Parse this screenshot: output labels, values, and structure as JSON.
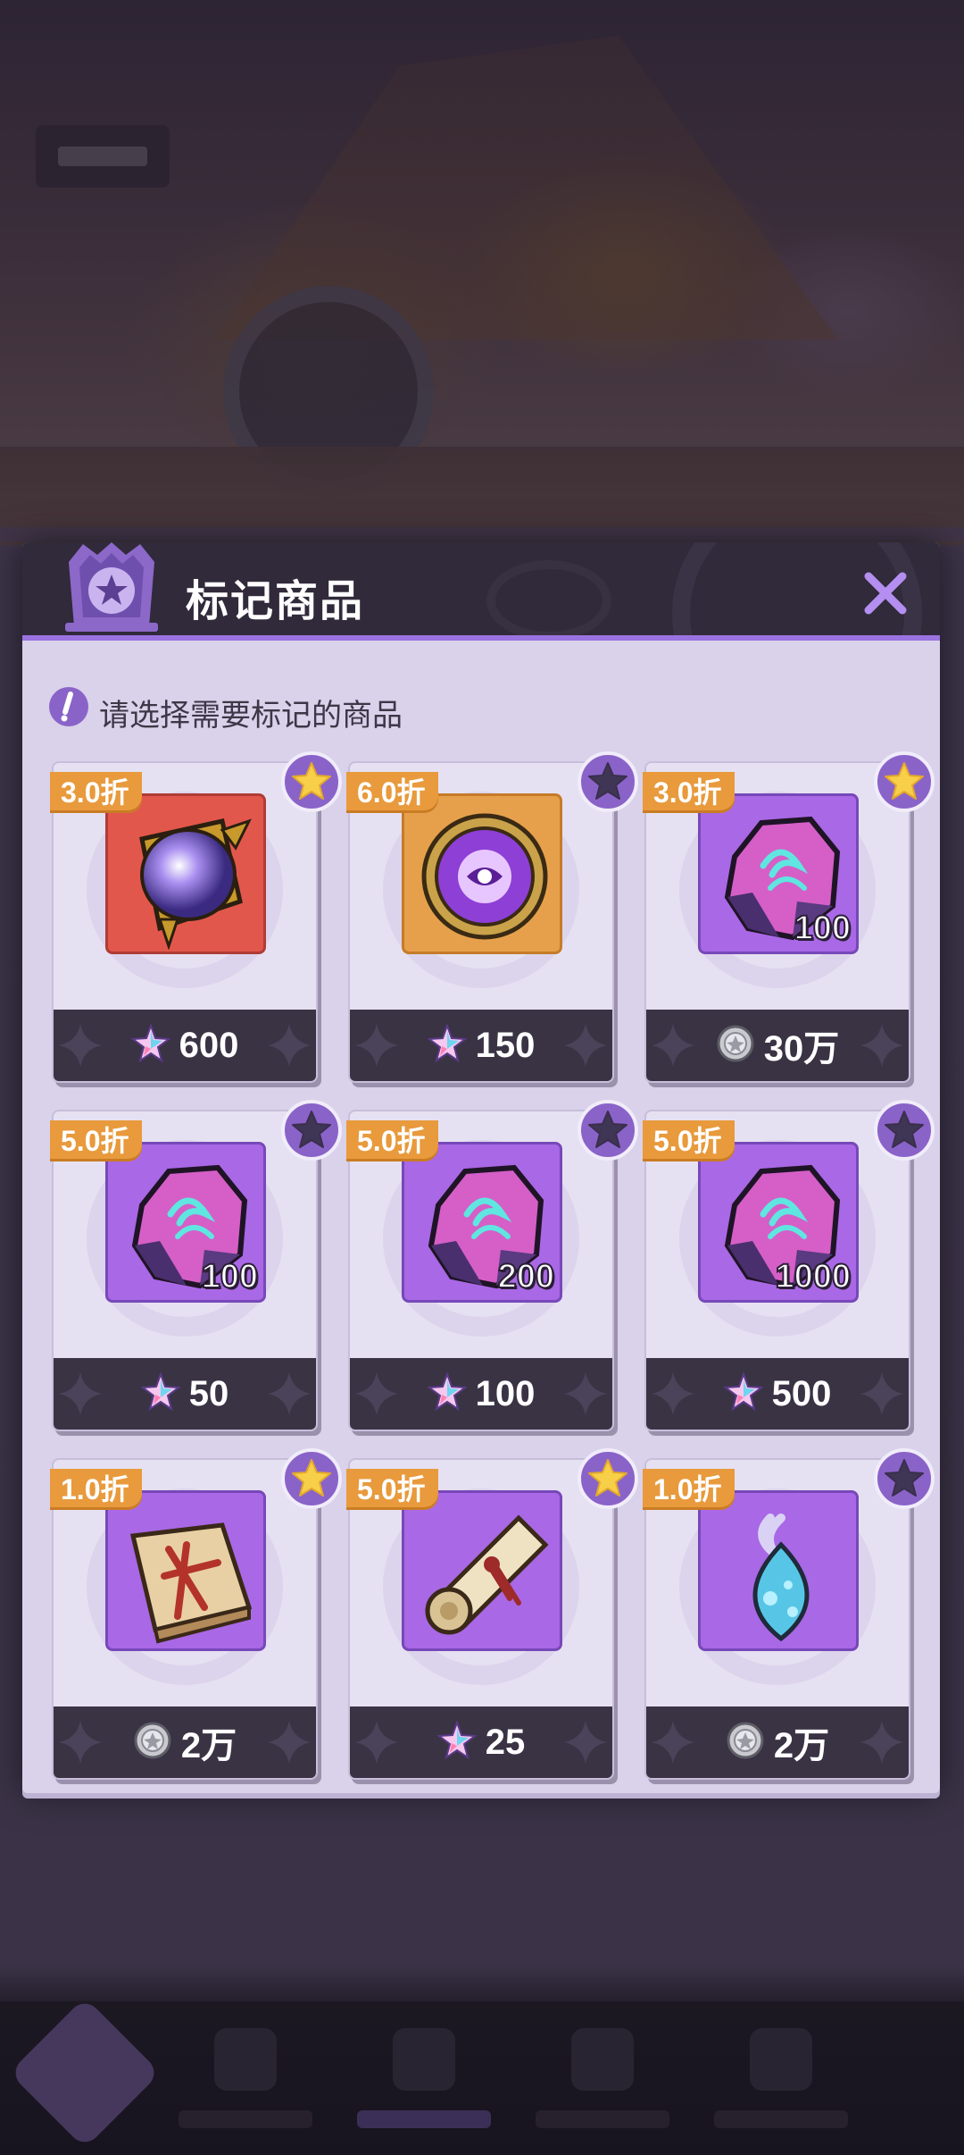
{
  "modal": {
    "title": "标记商品",
    "hint": "请选择需要标记的商品"
  },
  "colors": {
    "accent_purple": "#9a73e0",
    "discount_orange": "#e89a3c",
    "star_gold": "#f7cf48",
    "star_unmarked": "#3f3554"
  },
  "items": [
    {
      "discount": "3.0折",
      "price": "600",
      "currency_icon": "star-crystal-icon",
      "item_icon": "crystal-orb-icon",
      "frame": "red",
      "quantity": "",
      "marked": true
    },
    {
      "discount": "6.0折",
      "price": "150",
      "currency_icon": "star-crystal-icon",
      "item_icon": "eye-medallion-icon",
      "frame": "orange",
      "quantity": "",
      "marked": false
    },
    {
      "discount": "3.0折",
      "price": "30万",
      "currency_icon": "silver-coin-icon",
      "item_icon": "purple-ore-icon",
      "frame": "purple",
      "quantity": "100",
      "marked": true
    },
    {
      "discount": "5.0折",
      "price": "50",
      "currency_icon": "star-crystal-icon",
      "item_icon": "purple-ore-icon",
      "frame": "purple",
      "quantity": "100",
      "marked": false
    },
    {
      "discount": "5.0折",
      "price": "100",
      "currency_icon": "star-crystal-icon",
      "item_icon": "purple-ore-icon",
      "frame": "purple",
      "quantity": "200",
      "marked": false
    },
    {
      "discount": "5.0折",
      "price": "500",
      "currency_icon": "star-crystal-icon",
      "item_icon": "purple-ore-icon",
      "frame": "purple",
      "quantity": "1000",
      "marked": false
    },
    {
      "discount": "1.0折",
      "price": "2万",
      "currency_icon": "silver-coin-icon",
      "item_icon": "skill-book-icon",
      "frame": "purple",
      "quantity": "",
      "marked": true
    },
    {
      "discount": "5.0折",
      "price": "25",
      "currency_icon": "star-crystal-icon",
      "item_icon": "scroll-icon",
      "frame": "purple",
      "quantity": "",
      "marked": true
    },
    {
      "discount": "1.0折",
      "price": "2万",
      "currency_icon": "silver-coin-icon",
      "item_icon": "spirit-flame-icon",
      "frame": "purple",
      "quantity": "",
      "marked": false
    }
  ]
}
